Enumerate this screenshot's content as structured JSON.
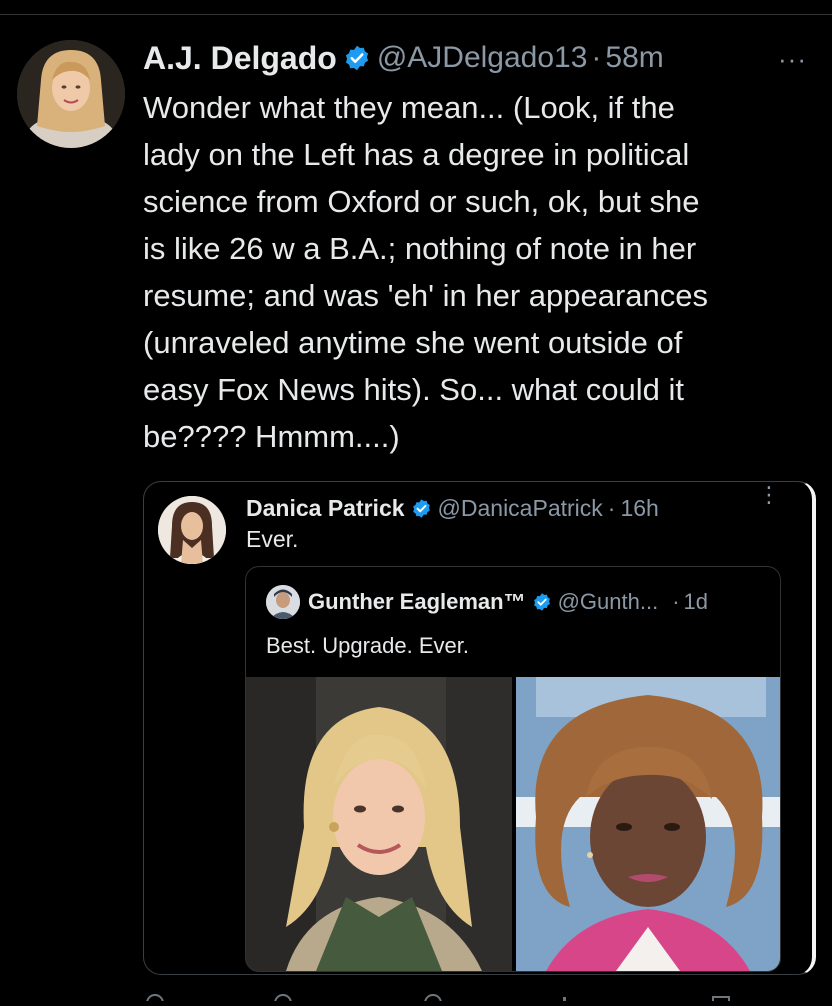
{
  "tweet": {
    "author_name": "A.J. Delgado",
    "handle": "@AJDelgado13",
    "separator": "·",
    "time": "58m",
    "more": "···",
    "text": "Wonder what they mean... (Look, if the\nlady on the Left has a degree in political\nscience from Oxford or such, ok, but she\nis like 26 w a B.A.; nothing of note in her\nresume; and was 'eh' in her appearances\n(unraveled anytime she went outside of\neasy Fox News hits). So... what could it\nbe???? Hmmm....)"
  },
  "quote": {
    "author_name": "Danica Patrick",
    "handle": "@DanicaPatrick",
    "separator": "·",
    "time": "16h",
    "more": "⋮",
    "text": "Ever."
  },
  "inner_quote": {
    "author_name": "Gunther Eagleman™",
    "handle": "@Gunth...",
    "separator": "·",
    "time": "1d",
    "text": "Best. Upgrade. Ever."
  },
  "colors": {
    "background": "#000000",
    "text": "#e7e9ea",
    "muted": "#8b98a5",
    "verified": "#1d9bf0"
  }
}
